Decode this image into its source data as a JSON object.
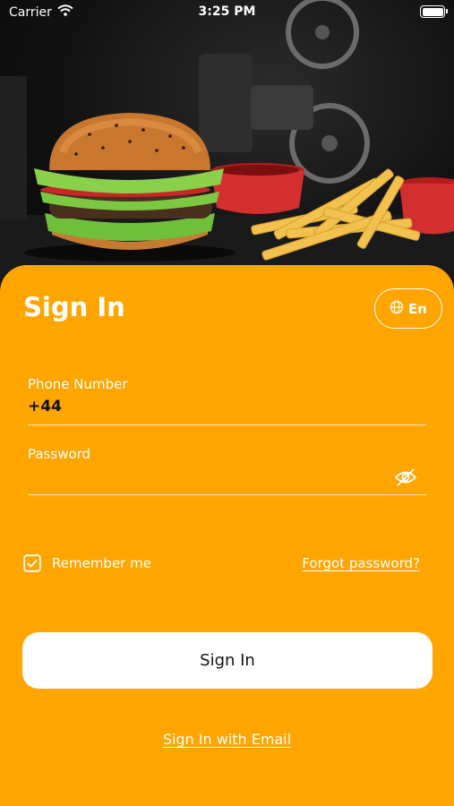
{
  "status_bar": {
    "carrier": "Carrier",
    "time": "3:25 PM"
  },
  "header": {
    "title": "Sign In",
    "language_label": "En"
  },
  "form": {
    "phone": {
      "label": "Phone Number",
      "value": "+44"
    },
    "password": {
      "label": "Password",
      "value": ""
    },
    "remember_me": {
      "label": "Remember me",
      "checked": true
    },
    "forgot_password": "Forgot password?",
    "submit_label": "Sign In",
    "alt_signin_link": "Sign In with Email"
  },
  "colors": {
    "accent": "#FFA500",
    "button_bg": "#FFFFFF",
    "text_dark": "#111111"
  },
  "icons": [
    "wifi-icon",
    "battery-icon",
    "globe-icon",
    "eye-off-icon",
    "checkbox-checked-icon"
  ]
}
